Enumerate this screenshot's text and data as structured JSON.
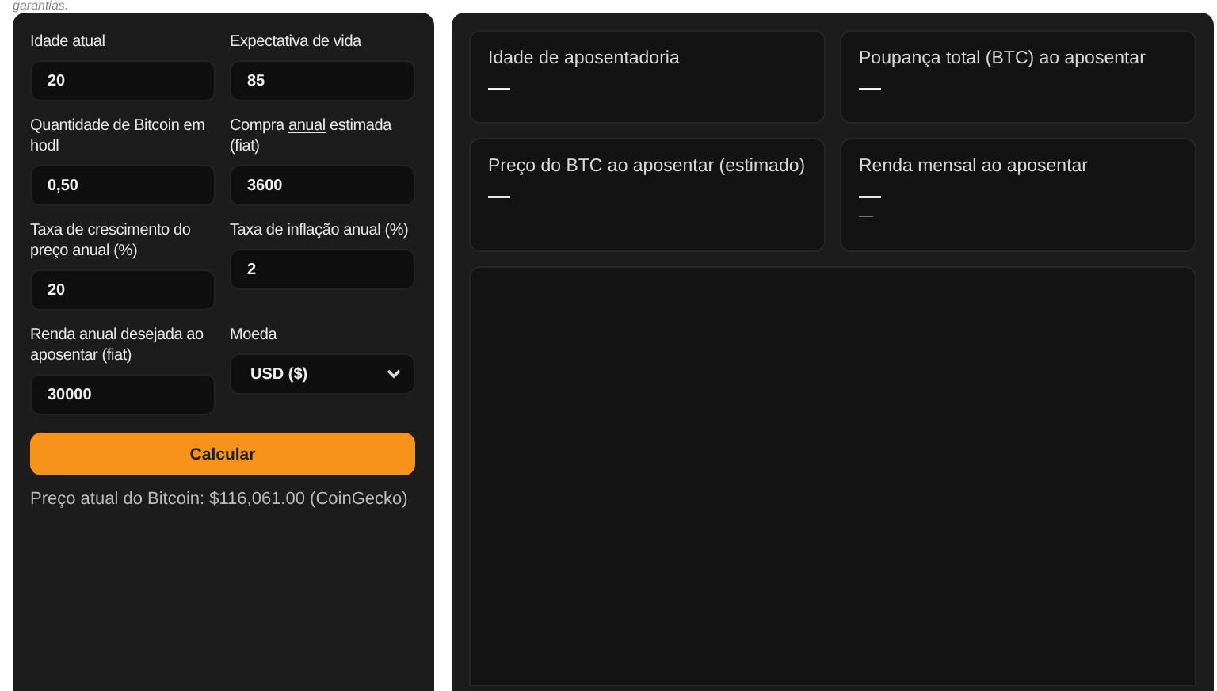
{
  "intro_text": "garantias.",
  "form": {
    "fields": [
      {
        "kind": "input",
        "label": [
          {
            "text": "Idade atual",
            "underline": false
          }
        ],
        "value": "20"
      },
      {
        "kind": "input",
        "label": [
          {
            "text": "Expectativa de vida",
            "underline": false
          }
        ],
        "value": "85"
      },
      {
        "kind": "input",
        "label": [
          {
            "text": "Quantidade de Bitcoin em hodl",
            "underline": false
          }
        ],
        "value": "0,50"
      },
      {
        "kind": "input",
        "label": [
          {
            "text": "Compra ",
            "underline": false
          },
          {
            "text": "anual",
            "underline": true
          },
          {
            "text": " estimada (fiat)",
            "underline": false
          }
        ],
        "value": "3600"
      },
      {
        "kind": "input",
        "label": [
          {
            "text": "Taxa de crescimento do preço anual (%)",
            "underline": false
          }
        ],
        "value": "20"
      },
      {
        "kind": "input",
        "label": [
          {
            "text": "Taxa de inflação anual (%)",
            "underline": false
          }
        ],
        "value": "2"
      },
      {
        "kind": "input",
        "label": [
          {
            "text": "Renda anual desejada ao aposentar (fiat)",
            "underline": false
          }
        ],
        "value": "30000"
      },
      {
        "kind": "select",
        "label": [
          {
            "text": "Moeda",
            "underline": false
          }
        ],
        "value": "USD ($)"
      }
    ],
    "button": "Calcular",
    "price_note": "Preço atual do Bitcoin: $116,061.00 (CoinGecko)"
  },
  "results": [
    {
      "label": "Idade de aposentadoria",
      "value": "—"
    },
    {
      "label": "Poupança total (BTC) ao aposentar",
      "value": "—"
    },
    {
      "label": "Preço do BTC ao aposentar (estimado)",
      "value": "—"
    },
    {
      "label": "Renda mensal ao aposentar",
      "value": "—",
      "sub": "—"
    }
  ]
}
